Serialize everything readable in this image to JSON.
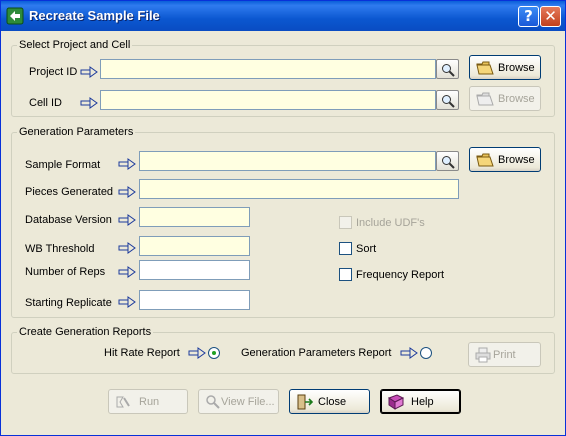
{
  "window": {
    "title": "Recreate Sample File",
    "help_label": "?",
    "close_label": "✕"
  },
  "project_cell": {
    "legend": "Select Project and Cell",
    "project_id_label": "Project ID",
    "project_id_value": "",
    "cell_id_label": "Cell ID",
    "cell_id_value": "",
    "browse_label": "Browse",
    "browse2_label": "Browse"
  },
  "generation": {
    "legend": "Generation Parameters",
    "sample_format_label": "Sample Format",
    "sample_format_value": "",
    "pieces_generated_label": "Pieces Generated",
    "pieces_generated_value": "",
    "database_version_label": "Database Version",
    "database_version_value": "",
    "wb_threshold_label": "WB Threshold",
    "wb_threshold_value": "",
    "number_of_reps_label": "Number of Reps",
    "number_of_reps_value": "",
    "starting_replicate_label": "Starting Replicate",
    "starting_replicate_value": "",
    "browse_label": "Browse",
    "include_udfs_label": "Include UDF's",
    "sort_label": "Sort",
    "frequency_report_label": "Frequency Report"
  },
  "reports": {
    "legend": "Create Generation Reports",
    "hit_rate_label": "Hit Rate Report",
    "gen_params_label": "Generation Parameters Report",
    "print_label": "Print"
  },
  "footer": {
    "run_label": "Run",
    "view_file_label": "View File...",
    "close_label": "Close",
    "help_label": "Help"
  }
}
